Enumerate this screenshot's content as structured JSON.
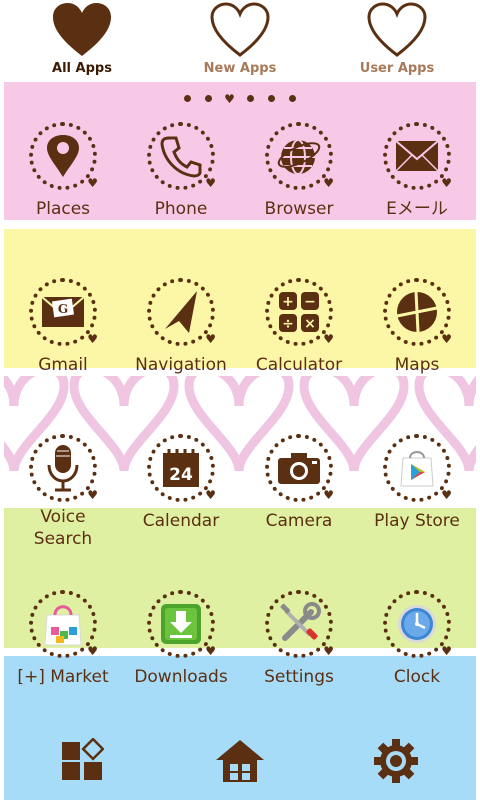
{
  "tabs": [
    {
      "label": "All Apps",
      "active": true
    },
    {
      "label": "New Apps",
      "active": false
    },
    {
      "label": "User Apps",
      "active": false
    }
  ],
  "pager": {
    "count": 6,
    "current": 2
  },
  "apps": [
    {
      "label": "Places",
      "icon": "map-pin-icon"
    },
    {
      "label": "Phone",
      "icon": "phone-icon"
    },
    {
      "label": "Browser",
      "icon": "globe-icon"
    },
    {
      "label": "Eメール",
      "icon": "envelope-icon"
    },
    {
      "label": "Gmail",
      "icon": "gmail-icon"
    },
    {
      "label": "Navigation",
      "icon": "navigation-arrow-icon"
    },
    {
      "label": "Calculator",
      "icon": "calculator-icon"
    },
    {
      "label": "Maps",
      "icon": "maps-icon"
    },
    {
      "label": "Voice\nSearch",
      "icon": "microphone-icon"
    },
    {
      "label": "Calendar",
      "icon": "calendar-icon",
      "day": "24"
    },
    {
      "label": "Camera",
      "icon": "camera-icon"
    },
    {
      "label": "Play Store",
      "icon": "play-store-icon"
    },
    {
      "label": "[+] Market",
      "icon": "shopping-bag-icon"
    },
    {
      "label": "Downloads",
      "icon": "download-icon"
    },
    {
      "label": "Settings",
      "icon": "tools-icon"
    },
    {
      "label": "Clock",
      "icon": "clock-icon"
    }
  ],
  "dock": [
    {
      "icon": "app-drawer-icon"
    },
    {
      "icon": "home-icon"
    },
    {
      "icon": "gear-icon"
    }
  ],
  "colors": {
    "brown": "#5b2f12",
    "pink": "#f8c9e6",
    "yellow": "#fcf7a6",
    "green": "#dff0a3",
    "blue": "#a6dcf8"
  }
}
